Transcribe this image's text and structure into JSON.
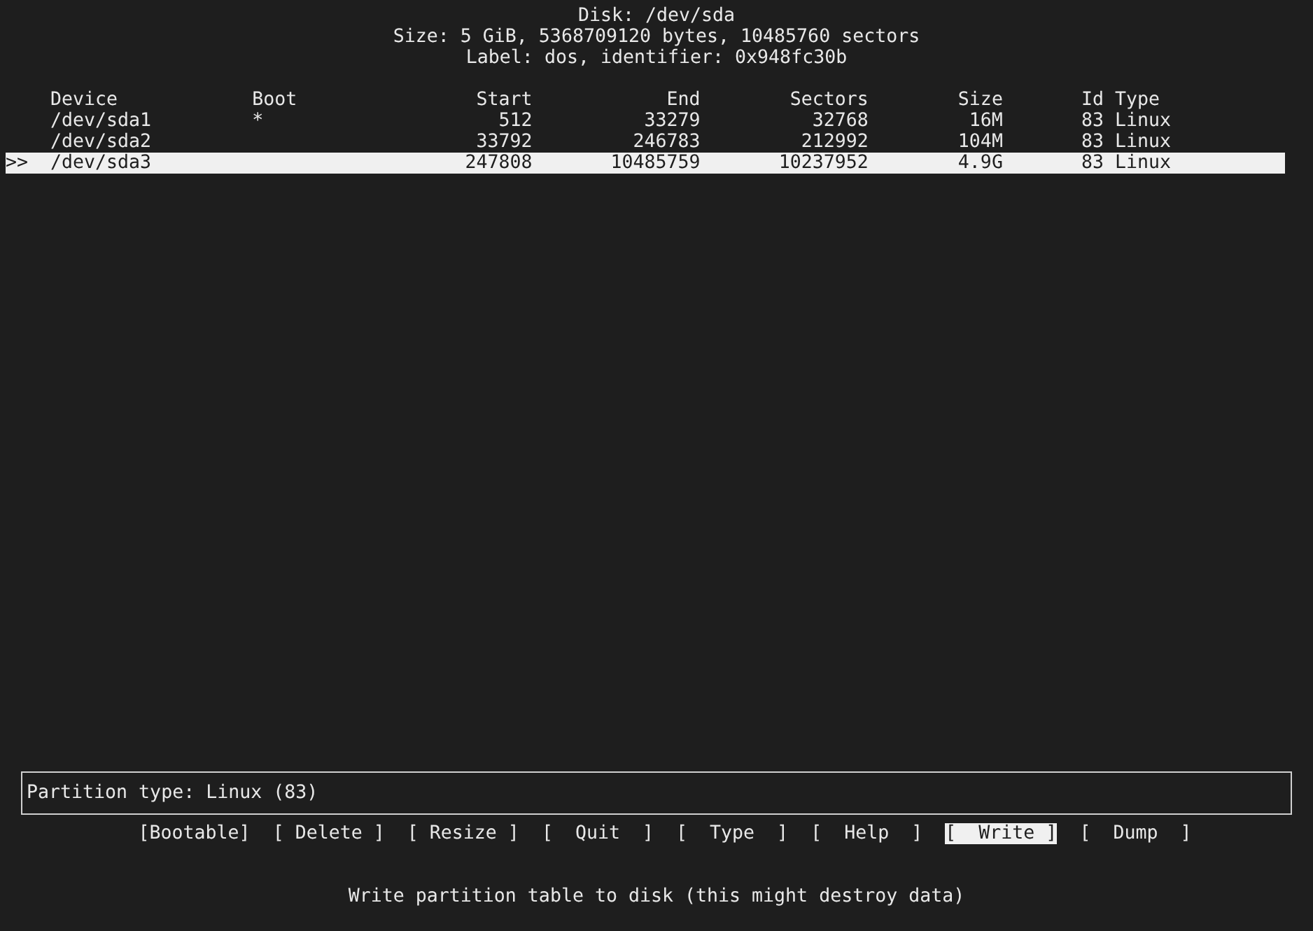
{
  "disk_info": [
    "Disk: /dev/sda",
    "Size: 5 GiB, 5368709120 bytes, 10485760 sectors",
    "Label: dos, identifier: 0x948fc30b"
  ],
  "table": {
    "columns": [
      "Device",
      "Boot",
      "Start",
      "End",
      "Sectors",
      "Size",
      "Id",
      "Type"
    ],
    "rows": [
      {
        "selected": false,
        "marker": "",
        "cells": [
          "/dev/sda1",
          "*",
          "512",
          "33279",
          "32768",
          "16M",
          "83",
          "Linux"
        ]
      },
      {
        "selected": false,
        "marker": "",
        "cells": [
          "/dev/sda2",
          "",
          "33792",
          "246783",
          "212992",
          "104M",
          "83",
          "Linux"
        ]
      },
      {
        "selected": true,
        "marker": ">>",
        "cells": [
          "/dev/sda3",
          "",
          "247808",
          "10485759",
          "10237952",
          "4.9G",
          "83",
          "Linux"
        ]
      }
    ]
  },
  "info_box": "Partition type: Linux (83)",
  "menu": [
    {
      "label": "[Bootable]",
      "selected": false
    },
    {
      "label": "[ Delete ]",
      "selected": false
    },
    {
      "label": "[ Resize ]",
      "selected": false
    },
    {
      "label": "[  Quit  ]",
      "selected": false
    },
    {
      "label": "[  Type  ]",
      "selected": false
    },
    {
      "label": "[  Help  ]",
      "selected": false
    },
    {
      "label": "[  Write ]",
      "selected": true
    },
    {
      "label": "[  Dump  ]",
      "selected": false
    }
  ],
  "hint": "Write partition table to disk (this might destroy data)"
}
